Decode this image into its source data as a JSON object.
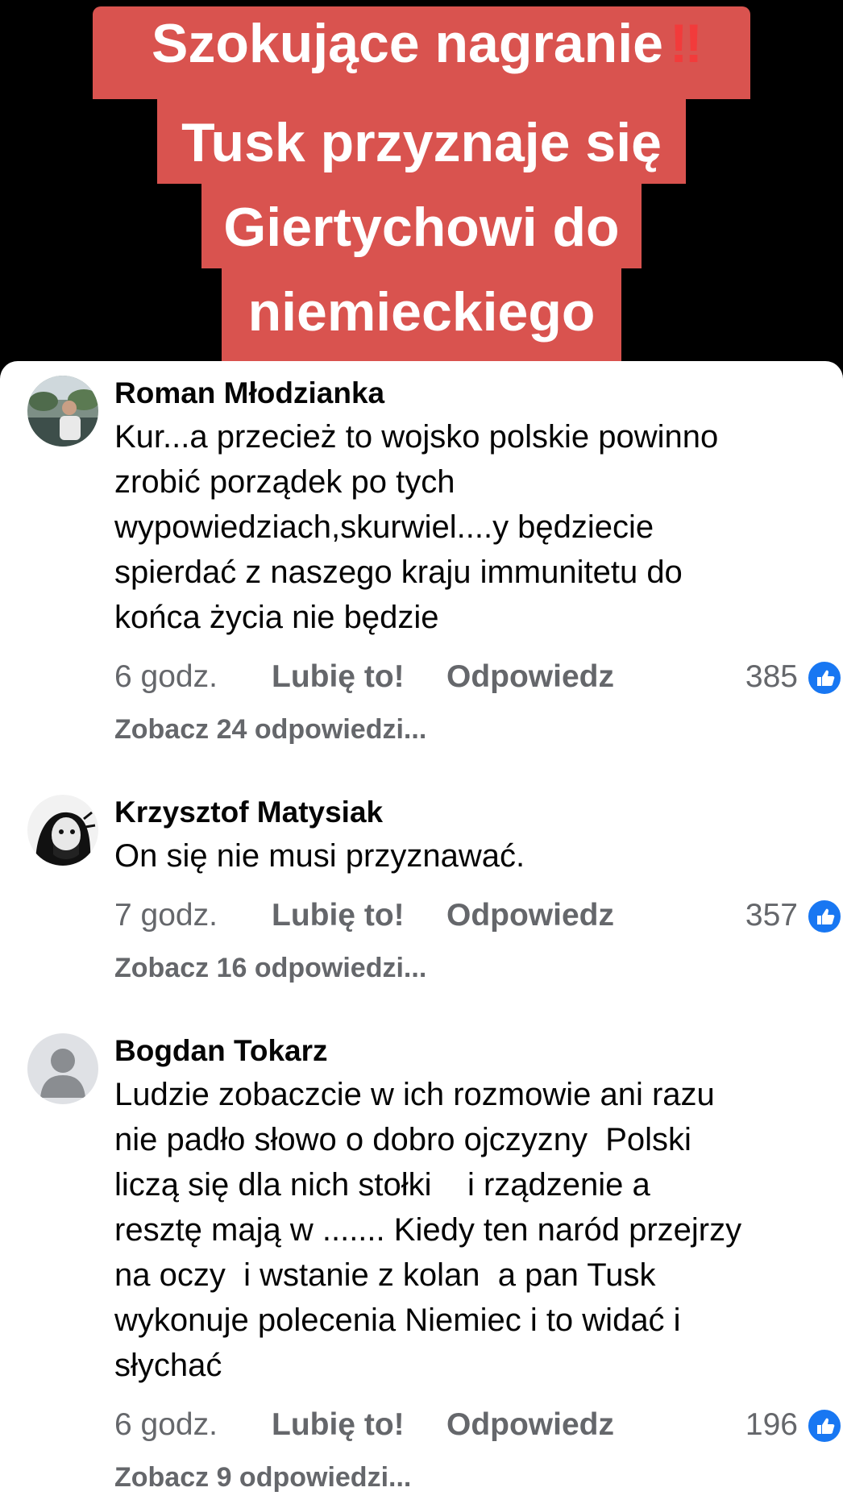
{
  "video": {
    "line1": "Szokujące nagranie",
    "line1_emoji": "‼",
    "line2": "Tusk przyznaje się",
    "line3": "Giertychowi do",
    "line4": "niemieckiego"
  },
  "colors": {
    "caption_bg": "#d9534f",
    "like_blue": "#1877f2",
    "meta_gray": "#65676b"
  },
  "comments": [
    {
      "author": "Roman Młodzianka",
      "text": "Kur...a przecież to wojsko polskie powinno\nzrobić porządek po tych\nwypowiedziach,skurwiel....y będziecie\nspierdać z naszego kraju immunitetu do\nkońca życia nie będzie",
      "time": "6 godz.",
      "like_label": "Lubię to!",
      "reply_label": "Odpowiedz",
      "reactions": "385",
      "reaction_icon": "like-icon",
      "view_replies": "Zobacz 24 odpowiedzi..."
    },
    {
      "author": "Krzysztof Matysiak",
      "text": "On się nie musi przyznawać.",
      "time": "7 godz.",
      "like_label": "Lubię to!",
      "reply_label": "Odpowiedz",
      "reactions": "357",
      "reaction_icon": "like-icon",
      "view_replies": "Zobacz 16 odpowiedzi..."
    },
    {
      "author": "Bogdan Tokarz",
      "text": "Ludzie zobaczcie w ich rozmowie ani razu\nnie padło słowo o dobro ojczyzny  Polski\nliczą się dla nich stołki    i rządzenie a\nresztę mają w ....... Kiedy ten naród przejrzy\nna oczy  i wstanie z kolan  a pan Tusk\nwykonuje polecenia Niemiec i to widać i\nsłychać",
      "time": "6 godz.",
      "like_label": "Lubię to!",
      "reply_label": "Odpowiedz",
      "reactions": "196",
      "reaction_icon": "like-icon",
      "view_replies": "Zobacz 9 odpowiedzi..."
    }
  ]
}
